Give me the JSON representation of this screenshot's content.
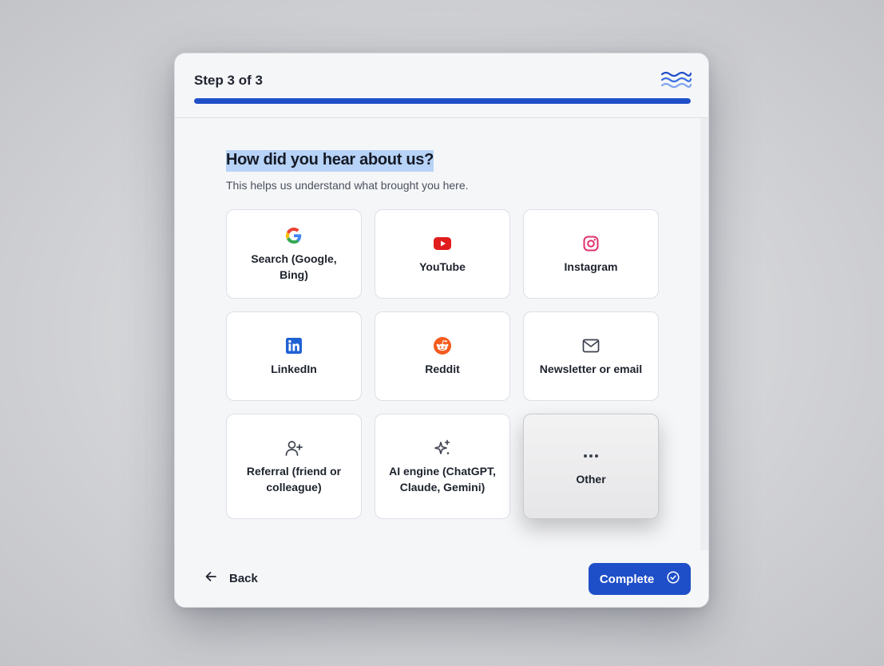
{
  "header": {
    "step_label": "Step 3 of 3",
    "progress_percent": 100,
    "logo_icon": "waves-logo-icon"
  },
  "question": {
    "title": "How did you hear about us?",
    "subtitle": "This helps us understand what brought you here."
  },
  "options": [
    {
      "label": "Search (Google, Bing)",
      "icon": "google-icon"
    },
    {
      "label": "YouTube",
      "icon": "youtube-icon"
    },
    {
      "label": "Instagram",
      "icon": "instagram-icon"
    },
    {
      "label": "LinkedIn",
      "icon": "linkedin-icon"
    },
    {
      "label": "Reddit",
      "icon": "reddit-icon"
    },
    {
      "label": "Newsletter or email",
      "icon": "mail-icon"
    },
    {
      "label": "Referral (friend or colleague)",
      "icon": "user-plus-icon"
    },
    {
      "label": "AI engine (ChatGPT, Claude, Gemini)",
      "icon": "sparkles-icon"
    },
    {
      "label": "Other",
      "icon": "more-horizontal-icon"
    }
  ],
  "footer": {
    "back_label": "Back",
    "complete_label": "Complete"
  },
  "colors": {
    "accent": "#1f4fc8",
    "highlight": "#b7d3f7"
  }
}
